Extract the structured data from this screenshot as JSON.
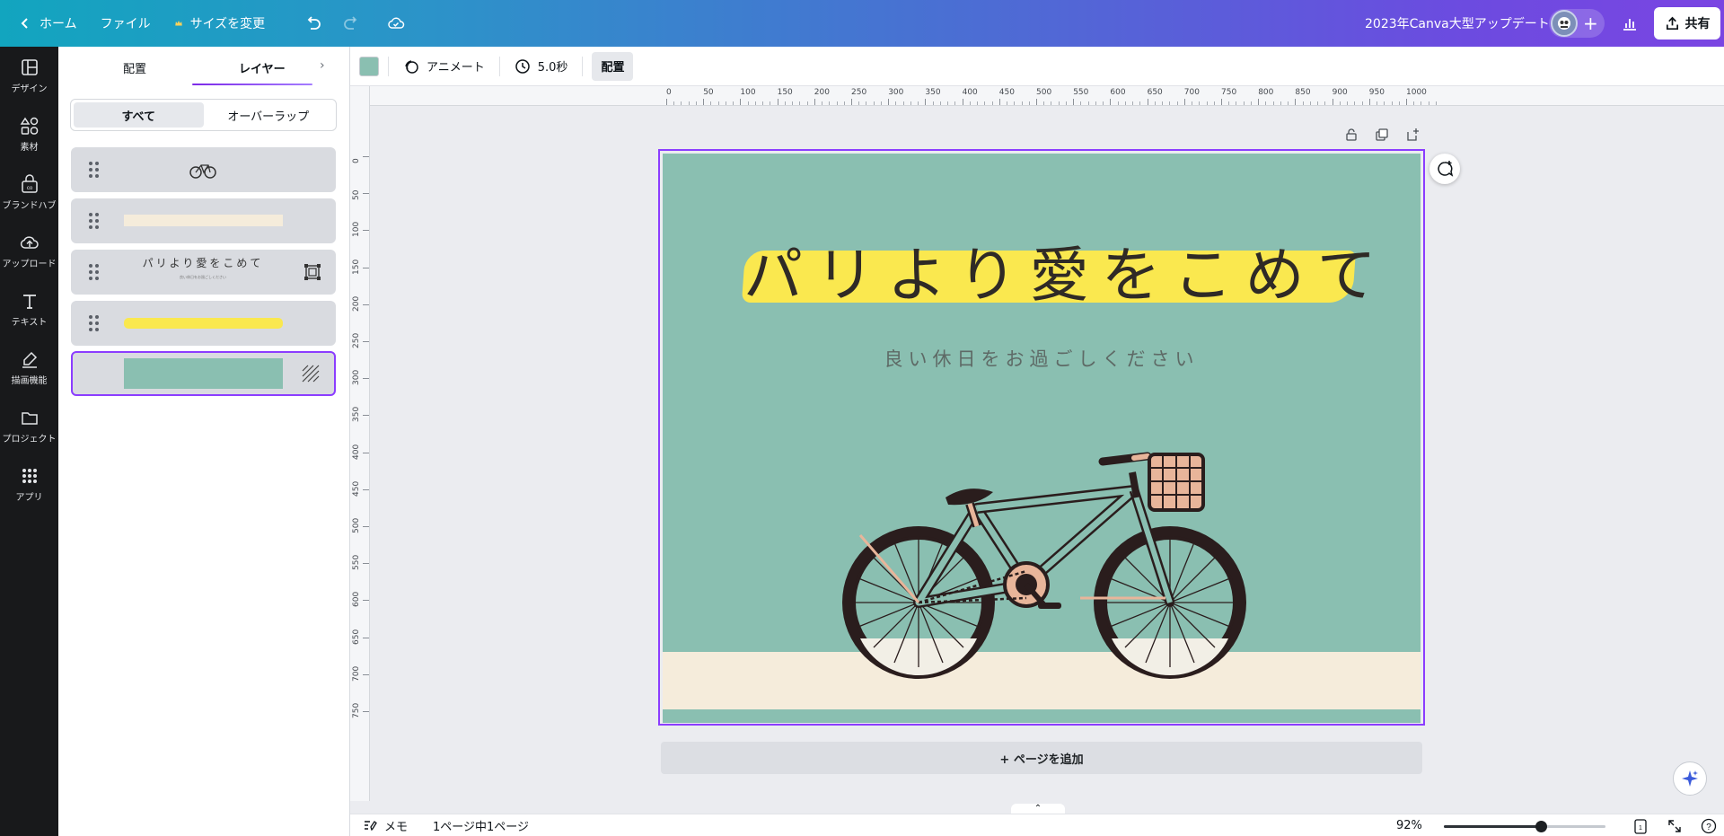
{
  "topbar": {
    "home_label": "ホーム",
    "file_label": "ファイル",
    "resize_label": "サイズを変更",
    "doc_title": "2023年Canva大型アップデート",
    "share_label": "共有"
  },
  "rail": [
    {
      "label": "デザイン",
      "icon": "design-icon"
    },
    {
      "label": "素材",
      "icon": "elements-icon"
    },
    {
      "label": "ブランドハブ",
      "icon": "brand-hub-icon"
    },
    {
      "label": "アップロード",
      "icon": "upload-icon"
    },
    {
      "label": "テキスト",
      "icon": "text-icon"
    },
    {
      "label": "描画機能",
      "icon": "draw-icon"
    },
    {
      "label": "プロジェクト",
      "icon": "folder-icon"
    },
    {
      "label": "アプリ",
      "icon": "apps-icon"
    }
  ],
  "panel": {
    "tab_arrange": "配置",
    "tab_layers": "レイヤー",
    "seg_all": "すべて",
    "seg_overlap": "オーバーラップ",
    "layer_text_thumb": "パリより愛をこめて",
    "layer_text_thumb_sub": "良い休日をお過ごしください"
  },
  "canvas_toolbar": {
    "color": "#8abfb1",
    "animate_label": "アニメート",
    "duration_label": "5.0秒",
    "position_label": "配置"
  },
  "ruler": {
    "h_labels": [
      "0",
      "50",
      "100",
      "150",
      "200",
      "250",
      "300",
      "350",
      "400",
      "450",
      "500",
      "550",
      "600",
      "650",
      "700",
      "750",
      "800",
      "850",
      "900",
      "950",
      "1000"
    ],
    "v_labels": [
      "0",
      "50",
      "100",
      "150",
      "200",
      "250",
      "300",
      "350",
      "400",
      "450",
      "500",
      "550",
      "600",
      "650",
      "700",
      "750"
    ]
  },
  "design": {
    "title": "パリより愛をこめて",
    "subtitle": "良い休日をお過ごしください",
    "bg_color": "#8abfb1",
    "ground_color": "#f5ecdb",
    "highlight_color": "#fae84f"
  },
  "add_page_label": "+ ページを追加",
  "bottombar": {
    "notes_label": "メモ",
    "page_info": "1ページ中1ページ",
    "zoom_label": "92%",
    "zoom_value": 0.6,
    "page_count": "1"
  }
}
